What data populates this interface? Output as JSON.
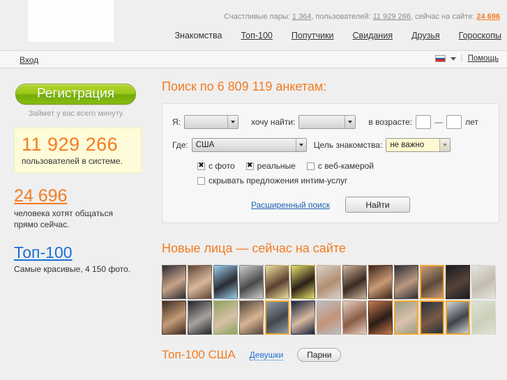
{
  "header": {
    "logo_alt": "site-logo",
    "stats": {
      "couples_label": "Счастливые пары:",
      "couples_value": "1 364",
      "sep1": ", ",
      "users_label": "пользователей:",
      "users_value": "11 929 266",
      "sep2": ", ",
      "online_label": "сейчас на сайте:",
      "online_value": "24 696"
    },
    "nav": [
      {
        "label": "Знакомства",
        "current": true
      },
      {
        "label": "Топ-100",
        "current": false
      },
      {
        "label": "Попутчики",
        "current": false
      },
      {
        "label": "Свидания",
        "current": false
      },
      {
        "label": "Друзья",
        "current": false
      },
      {
        "label": "Гороскопы",
        "current": false
      }
    ]
  },
  "subbar": {
    "enter_label": "Вход",
    "language_flag": "ru-flag-icon",
    "divider": "|",
    "help_label": "Помощь"
  },
  "sidebar": {
    "register_button": "Регистрация",
    "register_note": "Займет у вас всего минуту.",
    "users_count": "11 929 266",
    "users_caption": "пользователей в системе.",
    "online_count": "24 696",
    "online_caption_line1": "человека хотят общаться",
    "online_caption_line2": "прямо сейчас.",
    "top100_link": "Топ-100",
    "top100_caption": "Самые красивые, 4 150 фото."
  },
  "search": {
    "title": "Поиск по 6 809 119 анкетам:",
    "i_am_label": "Я:",
    "i_am_value": "",
    "want_label": "хочу найти:",
    "want_value": "",
    "age_label": "в возрасте:",
    "age_from": "",
    "age_dash": "—",
    "age_to": "",
    "age_units": "лет",
    "where_label": "Где:",
    "where_value": "США",
    "goal_label": "Цель знакомства:",
    "goal_value": "не важно",
    "checkboxes": [
      {
        "label": "с фото",
        "checked": true,
        "mark": "✖"
      },
      {
        "label": "реальные",
        "checked": true,
        "mark": "✖"
      },
      {
        "label": "с веб-камерой",
        "checked": false,
        "mark": ""
      }
    ],
    "hide_intim_label": "скрывать предложения интим-услуг",
    "hide_intim_checked": false,
    "advanced_link": "Расширенный поиск",
    "find_button": "Найти"
  },
  "new_faces": {
    "title": "Новые лица — сейчас на сайте",
    "photos": [
      {
        "name": "profile-thumb-1",
        "c1": "#2b2b33",
        "c2": "#c8a388",
        "highlight": false
      },
      {
        "name": "profile-thumb-2",
        "c1": "#5c4334",
        "c2": "#d9b79c",
        "highlight": false
      },
      {
        "name": "profile-thumb-3",
        "c1": "#9ed0ea",
        "c2": "#2a2a33",
        "highlight": false
      },
      {
        "name": "profile-thumb-4",
        "c1": "#cfcfcf",
        "c2": "#4a4a4a",
        "highlight": false
      },
      {
        "name": "profile-thumb-5",
        "c1": "#efe2a0",
        "c2": "#5c4030",
        "highlight": false
      },
      {
        "name": "profile-thumb-6",
        "c1": "#e8e06a",
        "c2": "#2a2018",
        "highlight": false
      },
      {
        "name": "profile-thumb-7",
        "c1": "#d9d2c6",
        "c2": "#b08f72",
        "highlight": false
      },
      {
        "name": "profile-thumb-8",
        "c1": "#cdb59c",
        "c2": "#3b2a22",
        "highlight": false
      },
      {
        "name": "profile-thumb-9",
        "c1": "#3a2218",
        "c2": "#c89a76",
        "highlight": false
      },
      {
        "name": "profile-thumb-10",
        "c1": "#2d2d33",
        "c2": "#b99880",
        "highlight": false
      },
      {
        "name": "profile-thumb-11",
        "c1": "#c99a78",
        "c2": "#5b4a3c",
        "highlight": true
      },
      {
        "name": "profile-thumb-12",
        "c1": "#1a1a20",
        "c2": "#564238",
        "highlight": false
      },
      {
        "name": "profile-thumb-13",
        "c1": "#e5e5e0",
        "c2": "#c3bcae",
        "highlight": false
      },
      {
        "name": "profile-thumb-14",
        "c1": "#3a2a20",
        "c2": "#c59c78",
        "highlight": false
      },
      {
        "name": "profile-thumb-15",
        "c1": "#23232a",
        "c2": "#a8a29c",
        "highlight": false
      },
      {
        "name": "profile-thumb-16",
        "c1": "#8aa25e",
        "c2": "#d8c0a8",
        "highlight": false
      },
      {
        "name": "profile-thumb-17",
        "c1": "#4e4236",
        "c2": "#d8b496",
        "highlight": false
      },
      {
        "name": "profile-thumb-18",
        "c1": "#8e9aa6",
        "c2": "#43474c",
        "highlight": true
      },
      {
        "name": "profile-thumb-19",
        "c1": "#14203a",
        "c2": "#d8b9a0",
        "highlight": false
      },
      {
        "name": "profile-thumb-20",
        "c1": "#b9bfc4",
        "c2": "#c4947a",
        "highlight": false
      },
      {
        "name": "profile-thumb-21",
        "c1": "#e8cfc0",
        "c2": "#8a5d48",
        "highlight": false
      },
      {
        "name": "profile-thumb-22",
        "c1": "#c87a52",
        "c2": "#2b1c16",
        "highlight": false
      },
      {
        "name": "profile-thumb-23",
        "c1": "#9a9a86",
        "c2": "#d9c3ac",
        "highlight": true
      },
      {
        "name": "profile-thumb-24",
        "c1": "#243042",
        "c2": "#7a5a44",
        "highlight": true
      },
      {
        "name": "profile-thumb-25",
        "c1": "#cfd4d8",
        "c2": "#40444a",
        "highlight": true
      },
      {
        "name": "profile-thumb-26",
        "c1": "#dfe4d4",
        "c2": "#c9cfb8",
        "highlight": false
      }
    ]
  },
  "top100_section": {
    "heading": "Топ-100 США",
    "tab_girls": "Девушки",
    "tab_guys": "Парни"
  }
}
